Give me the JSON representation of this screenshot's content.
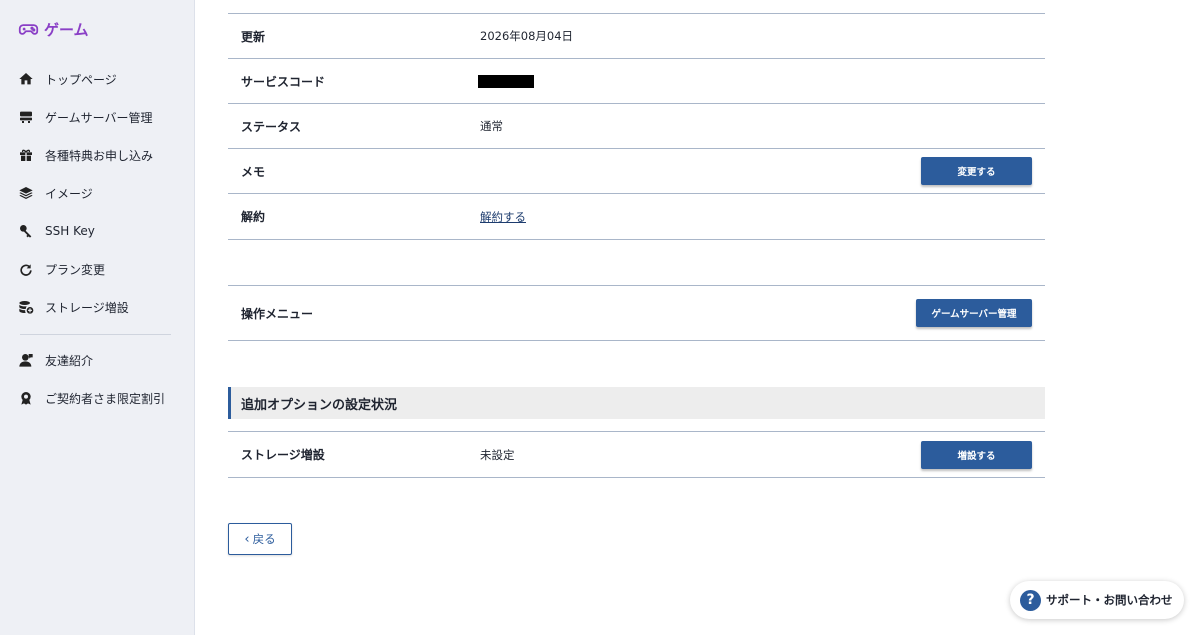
{
  "sidebar": {
    "brand": {
      "label": "ゲーム",
      "icon": "gamepad-icon",
      "color": "#8a3fc6"
    },
    "items": [
      {
        "label": "トップページ",
        "icon": "home-icon"
      },
      {
        "label": "ゲームサーバー管理",
        "icon": "server-icon"
      },
      {
        "label": "各種特典お申し込み",
        "icon": "gift-icon"
      },
      {
        "label": "イメージ",
        "icon": "layers-icon"
      },
      {
        "label": "SSH Key",
        "icon": "key-icon"
      },
      {
        "label": "プラン変更",
        "icon": "refresh-icon"
      },
      {
        "label": "ストレージ増設",
        "icon": "storage-icon"
      }
    ],
    "extra_items": [
      {
        "label": "友達紹介",
        "icon": "friend-icon"
      },
      {
        "label": "ご契約者さま限定割引",
        "icon": "discount-badge-icon"
      }
    ]
  },
  "details": {
    "updated": {
      "label": "更新",
      "value": "2026年08月04日"
    },
    "service_code": {
      "label": "サービスコード"
    },
    "status": {
      "label": "ステータス",
      "value": "通常"
    },
    "memo": {
      "label": "メモ",
      "button": "変更する"
    },
    "cancel": {
      "label": "解約",
      "link": "解約する"
    }
  },
  "operations": {
    "label": "操作メニュー",
    "button": "ゲームサーバー管理"
  },
  "options": {
    "heading": "追加オプションの設定状況",
    "storage": {
      "label": "ストレージ増設",
      "value": "未設定",
      "button": "増設する"
    }
  },
  "back_button": {
    "label": "戻る"
  },
  "support": {
    "label": "サポート・お問い合わせ",
    "icon_glyph": "?"
  },
  "colors": {
    "accent": "#2c5c9c",
    "brand": "#8a3fc6",
    "sidebar_bg": "#eef0f5"
  }
}
